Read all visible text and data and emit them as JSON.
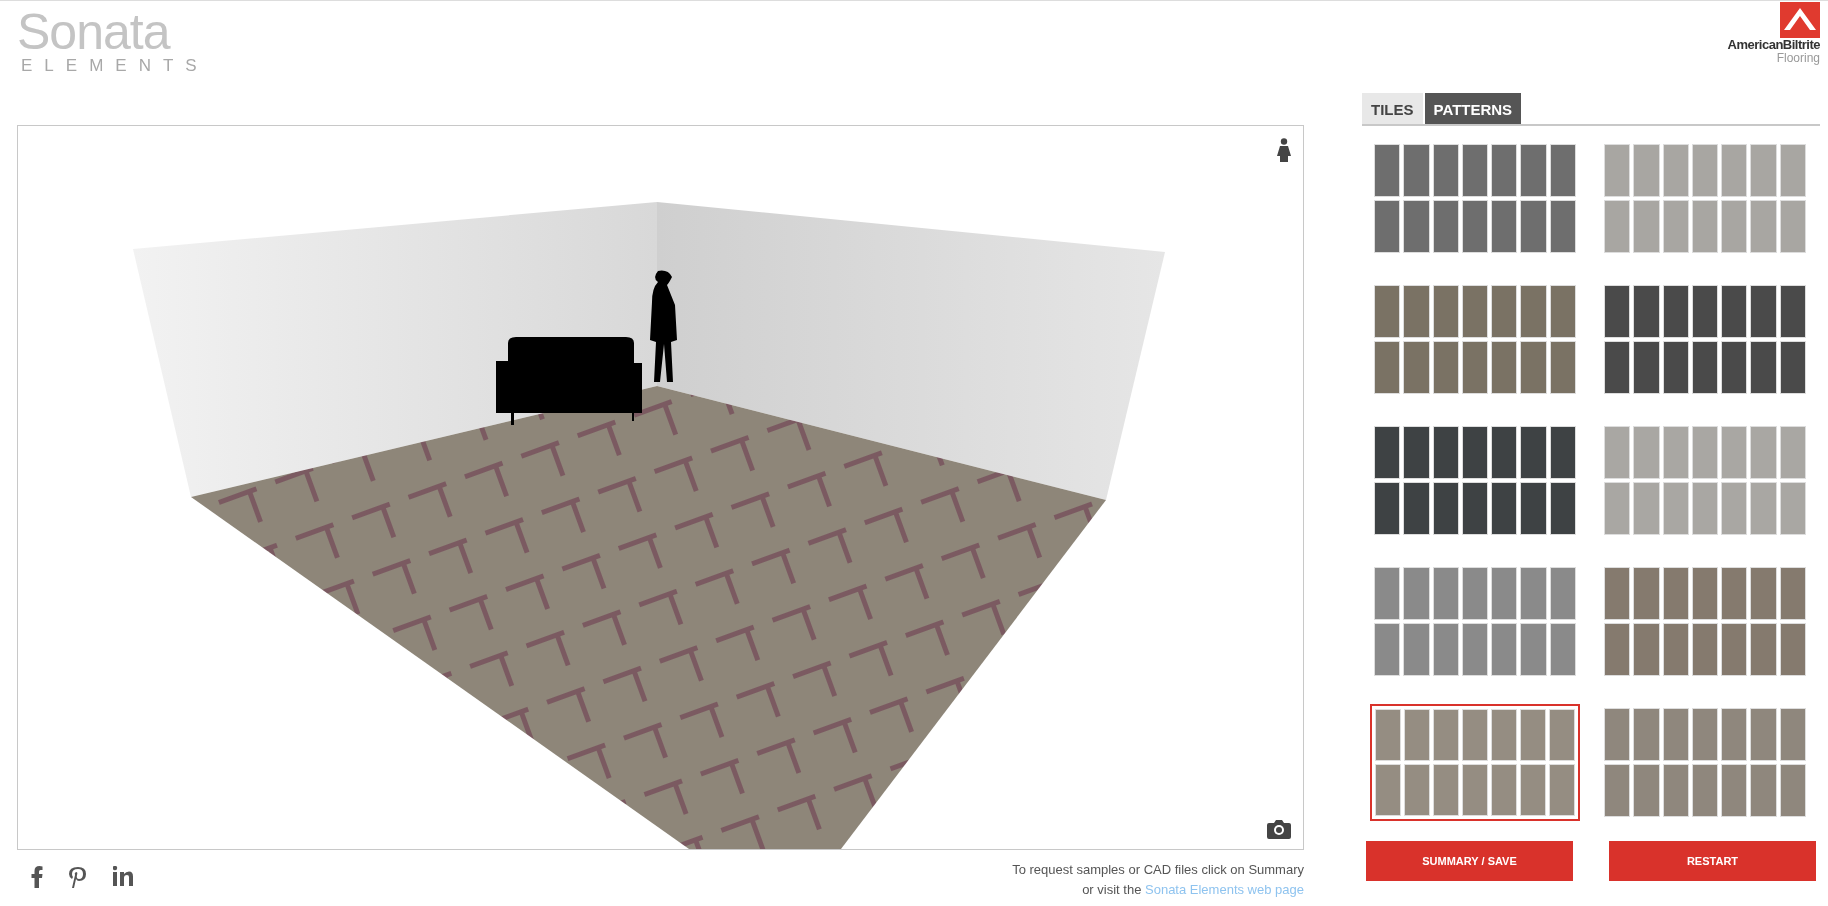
{
  "logo": {
    "title": "Sonata",
    "subtitle": "ELEMENTS"
  },
  "brand": {
    "name": "AmericanBiltrite",
    "subtitle": "Flooring"
  },
  "tabs": [
    {
      "label": "TILES",
      "selected": false
    },
    {
      "label": "PATTERNS",
      "selected": true
    }
  ],
  "patterns": [
    {
      "color": "#6e6e6e",
      "selected": false
    },
    {
      "color": "#a8a6a2",
      "selected": false
    },
    {
      "color": "#7a7264",
      "selected": false
    },
    {
      "color": "#4a4a4a",
      "selected": false
    },
    {
      "color": "#3e4244",
      "selected": false
    },
    {
      "color": "#a9a7a3",
      "selected": false
    },
    {
      "color": "#8a8a8a",
      "selected": false
    },
    {
      "color": "#857a6e",
      "selected": false
    },
    {
      "color": "#958d82",
      "selected": true
    },
    {
      "color": "#8f877d",
      "selected": false
    }
  ],
  "buttons": [
    "SUMMARY / SAVE",
    "RESTART"
  ],
  "footer": {
    "line1": "To request samples or CAD files click on Summary",
    "line2": "or visit the",
    "link": "Sonata Elements web page"
  }
}
